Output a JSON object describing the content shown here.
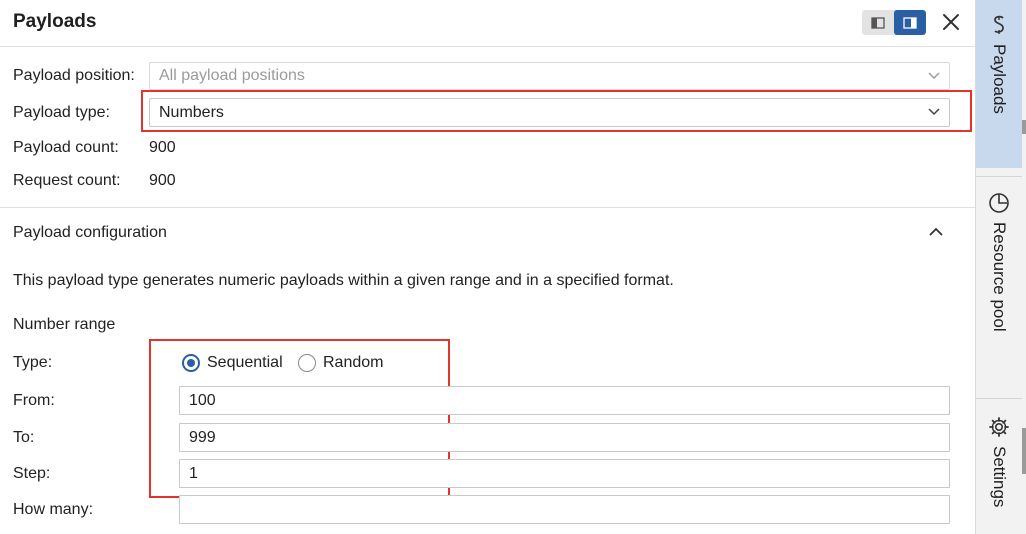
{
  "header": {
    "title": "Payloads"
  },
  "form": {
    "payload_position": {
      "label": "Payload position:",
      "placeholder": "All payload positions"
    },
    "payload_type": {
      "label": "Payload type:",
      "value": "Numbers"
    },
    "payload_count": {
      "label": "Payload count:",
      "value": "900"
    },
    "request_count": {
      "label": "Request count:",
      "value": "900"
    }
  },
  "config": {
    "section_title": "Payload configuration",
    "description": "This payload type generates numeric payloads within a given range and in a specified format.",
    "number_range": "Number range",
    "type": {
      "label": "Type:",
      "options": [
        "Sequential",
        "Random"
      ],
      "selected": "Sequential"
    },
    "from": {
      "label": "From:",
      "value": "100"
    },
    "to": {
      "label": "To:",
      "value": "999"
    },
    "step": {
      "label": "Step:",
      "value": "1"
    },
    "how_many": {
      "label": "How many:",
      "value": ""
    }
  },
  "sidebar": {
    "tabs": [
      {
        "label": "Payloads",
        "icon": "payloads-icon"
      },
      {
        "label": "Resource pool",
        "icon": "pie-chart-icon"
      },
      {
        "label": "Settings",
        "icon": "gear-icon"
      }
    ]
  },
  "colors": {
    "accent": "#2b5fa3",
    "highlight": "#e4332b",
    "active_tab": "#c8d9ee"
  }
}
